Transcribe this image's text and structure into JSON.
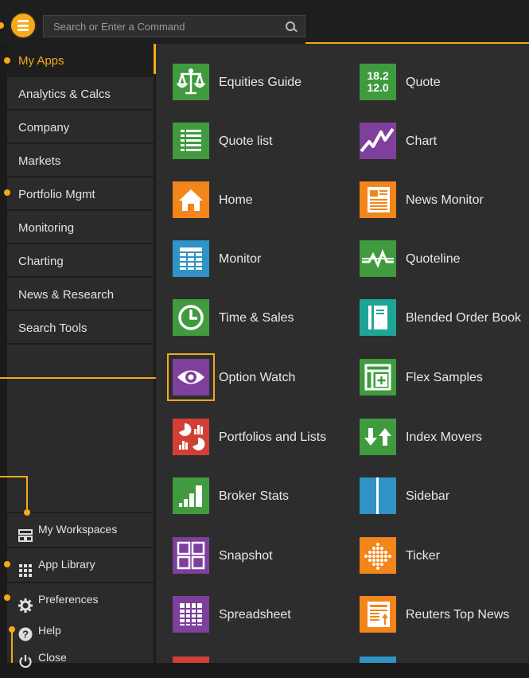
{
  "search": {
    "placeholder": "Search or Enter a Command"
  },
  "colors": {
    "accent": "#f7a81b",
    "green": "#3f9b3e",
    "orange": "#f2861b",
    "purple": "#7e3f9d",
    "blue": "#2f93c5",
    "teal": "#1fa596",
    "red": "#d23f34"
  },
  "sidebar": {
    "items": [
      {
        "label": "My Apps"
      },
      {
        "label": "Analytics & Calcs"
      },
      {
        "label": "Company"
      },
      {
        "label": "Markets"
      },
      {
        "label": "Portfolio Mgmt"
      },
      {
        "label": "Monitoring"
      },
      {
        "label": "Charting"
      },
      {
        "label": "News & Research"
      },
      {
        "label": "Search Tools"
      }
    ],
    "bottom": [
      {
        "label": "My Workspaces",
        "icon": "workspaces-icon"
      },
      {
        "label": "App Library",
        "icon": "grid-icon"
      },
      {
        "label": "Preferences",
        "icon": "gear-icon"
      },
      {
        "label": "Help",
        "icon": "question-icon"
      },
      {
        "label": "Close",
        "icon": "power-icon"
      }
    ]
  },
  "apps": [
    {
      "label": "Equities Guide",
      "icon": "scales-icon",
      "color": "#3f9b3e"
    },
    {
      "label": "Quote",
      "icon": "quote-numbers-icon",
      "color": "#3f9b3e",
      "tile_text": [
        "18.2",
        "12.0"
      ]
    },
    {
      "label": "Quote list",
      "icon": "list-icon",
      "color": "#3f9b3e"
    },
    {
      "label": "Chart",
      "icon": "line-chart-icon",
      "color": "#7e3f9d"
    },
    {
      "label": "Home",
      "icon": "home-icon",
      "color": "#f2861b"
    },
    {
      "label": "News Monitor",
      "icon": "news-icon",
      "color": "#f2861b"
    },
    {
      "label": "Monitor",
      "icon": "table-icon",
      "color": "#2f93c5"
    },
    {
      "label": "Quoteline",
      "icon": "quoteline-icon",
      "color": "#3f9b3e"
    },
    {
      "label": "Time & Sales",
      "icon": "clock-icon",
      "color": "#3f9b3e"
    },
    {
      "label": "Blended Order Book",
      "icon": "book-icon",
      "color": "#1fa596"
    },
    {
      "label": "Option Watch",
      "icon": "eye-icon",
      "color": "#7e3f9d"
    },
    {
      "label": "Flex Samples",
      "icon": "flex-icon",
      "color": "#3f9b3e"
    },
    {
      "label": "Portfolios and Lists",
      "icon": "portfolio-icon",
      "color": "#d23f34"
    },
    {
      "label": "Index Movers",
      "icon": "arrows-icon",
      "color": "#3f9b3e"
    },
    {
      "label": "Broker Stats",
      "icon": "bars-icon",
      "color": "#3f9b3e"
    },
    {
      "label": "Sidebar",
      "icon": "sidebar-icon",
      "color": "#2f93c5"
    },
    {
      "label": "Snapshot",
      "icon": "snapshot-icon",
      "color": "#7e3f9d"
    },
    {
      "label": "Ticker",
      "icon": "ticker-icon",
      "color": "#f2861b"
    },
    {
      "label": "Spreadsheet",
      "icon": "spreadsheet-icon",
      "color": "#7e3f9d"
    },
    {
      "label": "Reuters Top News",
      "icon": "top-news-icon",
      "color": "#f2861b"
    }
  ]
}
